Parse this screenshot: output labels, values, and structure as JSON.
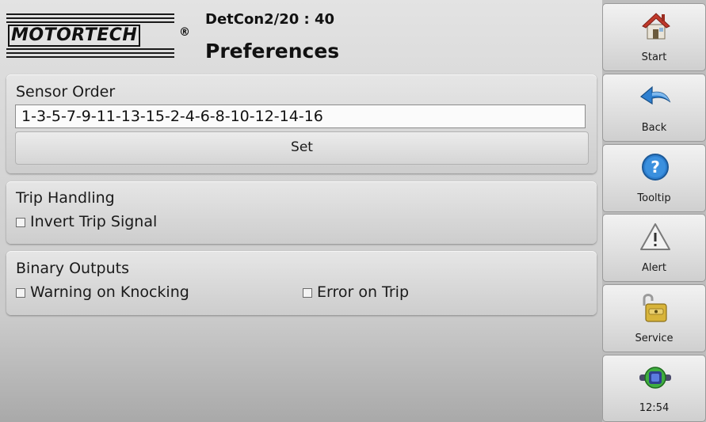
{
  "header": {
    "logo_text": "MOTORTECH",
    "logo_mark": "®",
    "device_name": "DetCon2/20 : 40",
    "page_title": "Preferences"
  },
  "sensor_order": {
    "title": "Sensor Order",
    "value": "1-3-5-7-9-11-13-15-2-4-6-8-10-12-14-16",
    "set_label": "Set"
  },
  "trip_handling": {
    "title": "Trip Handling",
    "invert_label": "Invert Trip Signal",
    "invert_checked": false
  },
  "binary_outputs": {
    "title": "Binary Outputs",
    "warning_label": "Warning on Knocking",
    "warning_checked": false,
    "error_label": "Error on Trip",
    "error_checked": false
  },
  "sidebar": {
    "items": [
      {
        "label": "Start",
        "icon": "house-icon"
      },
      {
        "label": "Back",
        "icon": "back-arrow-icon"
      },
      {
        "label": "Tooltip",
        "icon": "question-icon"
      },
      {
        "label": "Alert",
        "icon": "alert-triangle-icon"
      },
      {
        "label": "Service",
        "icon": "padlock-icon"
      },
      {
        "label": "12:54",
        "icon": "network-connection-icon"
      }
    ]
  },
  "colors": {
    "accent_blue": "#2d7fd0",
    "house_roof": "#c0392b",
    "lock_gold": "#d8b43a",
    "network_green": "#3fae3f"
  }
}
